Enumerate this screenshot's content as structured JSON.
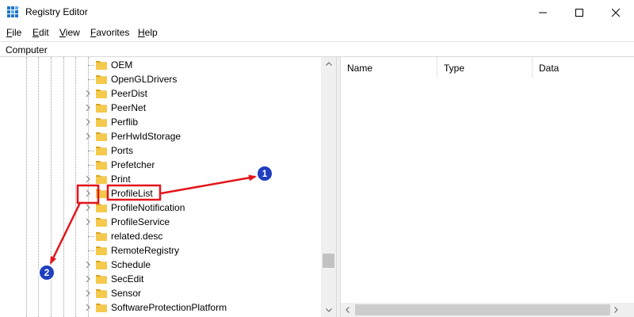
{
  "window": {
    "title": "Registry Editor",
    "controls": {
      "minimize": "—",
      "maximize": "☐",
      "close": "✕"
    }
  },
  "menu": [
    {
      "label": "File",
      "accel": "F",
      "rest": "ile"
    },
    {
      "label": "Edit",
      "accel": "E",
      "rest": "dit"
    },
    {
      "label": "View",
      "accel": "V",
      "rest": "iew"
    },
    {
      "label": "Favorites",
      "accel": "F",
      "rest": "avorites"
    },
    {
      "label": "Help",
      "accel": "H",
      "rest": "elp"
    }
  ],
  "address": {
    "path": "Computer"
  },
  "tree": {
    "items": [
      {
        "label": "OEM",
        "expandable": false
      },
      {
        "label": "OpenGLDrivers",
        "expandable": false
      },
      {
        "label": "PeerDist",
        "expandable": true
      },
      {
        "label": "PeerNet",
        "expandable": true
      },
      {
        "label": "Perflib",
        "expandable": true
      },
      {
        "label": "PerHwIdStorage",
        "expandable": true
      },
      {
        "label": "Ports",
        "expandable": false
      },
      {
        "label": "Prefetcher",
        "expandable": false
      },
      {
        "label": "Print",
        "expandable": true
      },
      {
        "label": "ProfileList",
        "expandable": true,
        "highlighted": true
      },
      {
        "label": "ProfileNotification",
        "expandable": true
      },
      {
        "label": "ProfileService",
        "expandable": true
      },
      {
        "label": "related.desc",
        "expandable": false
      },
      {
        "label": "RemoteRegistry",
        "expandable": false
      },
      {
        "label": "Schedule",
        "expandable": true
      },
      {
        "label": "SecEdit",
        "expandable": true
      },
      {
        "label": "Sensor",
        "expandable": true
      },
      {
        "label": "SoftwareProtectionPlatform",
        "expandable": true
      }
    ]
  },
  "list": {
    "columns": [
      "Name",
      "Type",
      "Data"
    ]
  },
  "annotations": {
    "badge_1": "1",
    "badge_2": "2",
    "arrow_color": "#e3141b",
    "badge_color": "#1f3fbf"
  },
  "colors": {
    "folder": "#f5c94c",
    "folder_dark": "#d9a520"
  }
}
